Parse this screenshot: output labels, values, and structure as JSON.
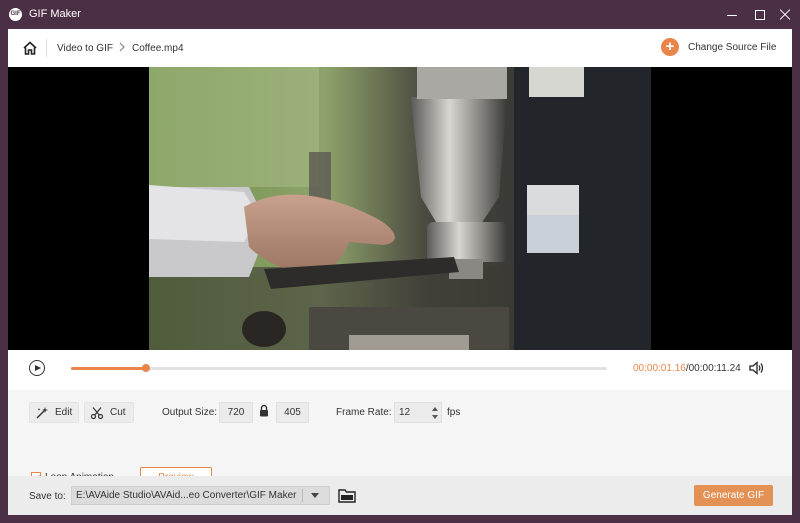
{
  "window": {
    "logo_text": "GIF",
    "title": "GIF Maker"
  },
  "nav": {
    "crumb_root": "Video to GIF",
    "crumb_file": "Coffee.mp4",
    "change_source": "Change Source File"
  },
  "player": {
    "progress_fraction": 0.14,
    "time_current": "00:00:01.16",
    "time_total": "/00:00:11.24"
  },
  "settings": {
    "edit_label": "Edit",
    "cut_label": "Cut",
    "output_size_label": "Output Size:",
    "width": "720",
    "height": "405",
    "frame_rate_label": "Frame Rate:",
    "frame_rate": "12",
    "fps_label": "fps",
    "loop_label": "Loop Animation",
    "loop_checked": true,
    "preview_label": "Preview"
  },
  "footer": {
    "save_to_label": "Save to:",
    "save_path": "E:\\AVAide Studio\\AVAid...eo Converter\\GIF Maker",
    "generate_label": "Generate GIF"
  },
  "colors": {
    "accent": "#e9854a",
    "titlebar": "#4a2f45"
  }
}
